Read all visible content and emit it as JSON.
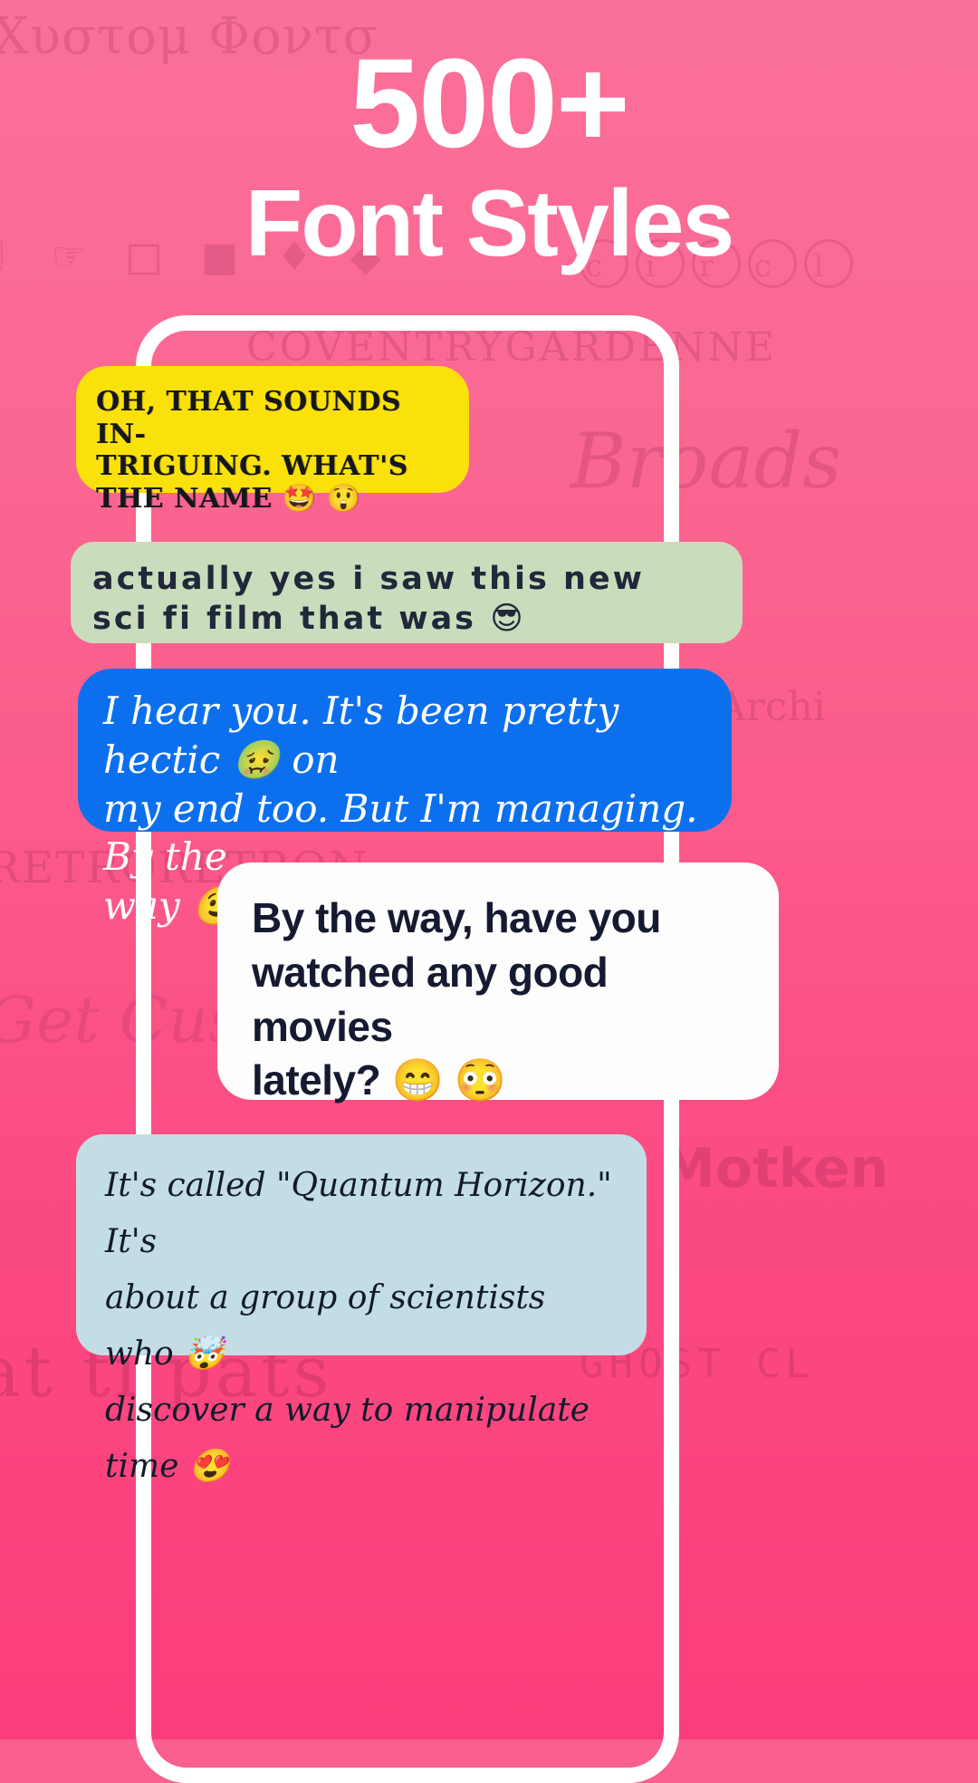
{
  "headline": {
    "number": "500+",
    "text": "Font Styles"
  },
  "watermarks": {
    "custom_fonts": "Χυστομ Φοντσ",
    "dingbats": "✌ ☞ □ ■ ♦ ◆",
    "circled": [
      "c",
      "i",
      "r",
      "c",
      "l"
    ],
    "coventry": "COVENTRYGARDENNE",
    "broads": "Broads",
    "archi": "Archi",
    "retro": "RETRORETRON",
    "get_custom": "Get Custom",
    "motken": "Motken",
    "arabic_ish": "at ti pats",
    "ghost": "GHOST CL"
  },
  "chat": {
    "messages": [
      {
        "id": "yellow",
        "style_name": "decorative-serif",
        "bg": "#FBE10A",
        "text_color": "#16171d",
        "align": "left",
        "lines": [
          "OH, THAT SOUNDS IN-",
          "TRIGUING. WHAT'S",
          "THE NAME 🤩 😲"
        ],
        "plain_text": "OH, THAT SOUNDS INTRIGUING. WHAT'S THE NAME 🤩 😲"
      },
      {
        "id": "sage",
        "style_name": "bubble-outline",
        "bg": "#CBDCBD",
        "text_color": "#20283a",
        "align": "left",
        "lines": [
          "actually yes i saw this new",
          "sci fi film that was 😎"
        ],
        "plain_text": "actually yes i saw this new sci fi film that was 😎"
      },
      {
        "id": "blue",
        "style_name": "script",
        "bg": "#0C70EE",
        "text_color": "#ffffff",
        "align": "left",
        "lines": [
          "I hear you. It's been pretty hectic 🤢 on",
          "my end too. But I'm managing. By the",
          "way 😉 😌"
        ],
        "plain_text": "I hear you. It's been pretty hectic 🤢 on my end too. But I'm managing. By the way 😉 😌"
      },
      {
        "id": "white",
        "style_name": "condensed-bold",
        "bg": "#FDFDFD",
        "text_color": "#161a31",
        "align": "right",
        "lines": [
          "By the way, have you",
          "watched any good movies",
          "lately? 😁 😳"
        ],
        "plain_text": "By the way, have you watched any good movies lately? 😁 😳"
      },
      {
        "id": "lightblue",
        "style_name": "calligraphy",
        "bg": "#C3DDE5",
        "text_color": "#121a2a",
        "align": "left",
        "lines": [
          "It's called \"Quantum Horizon.\" It's",
          "about a group of scientists who 🤯",
          "discover a way to manipulate time 😍"
        ],
        "plain_text": "It's called \"Quantum Horizon.\" It's about a group of scientists who 🤯 discover a way to manipulate time 😍"
      }
    ]
  },
  "theme": {
    "background_top": "#FA7099",
    "background_bottom": "#FB3E7B",
    "frame_color": "#FFFFFF",
    "headline_color": "#FFFFFF"
  }
}
